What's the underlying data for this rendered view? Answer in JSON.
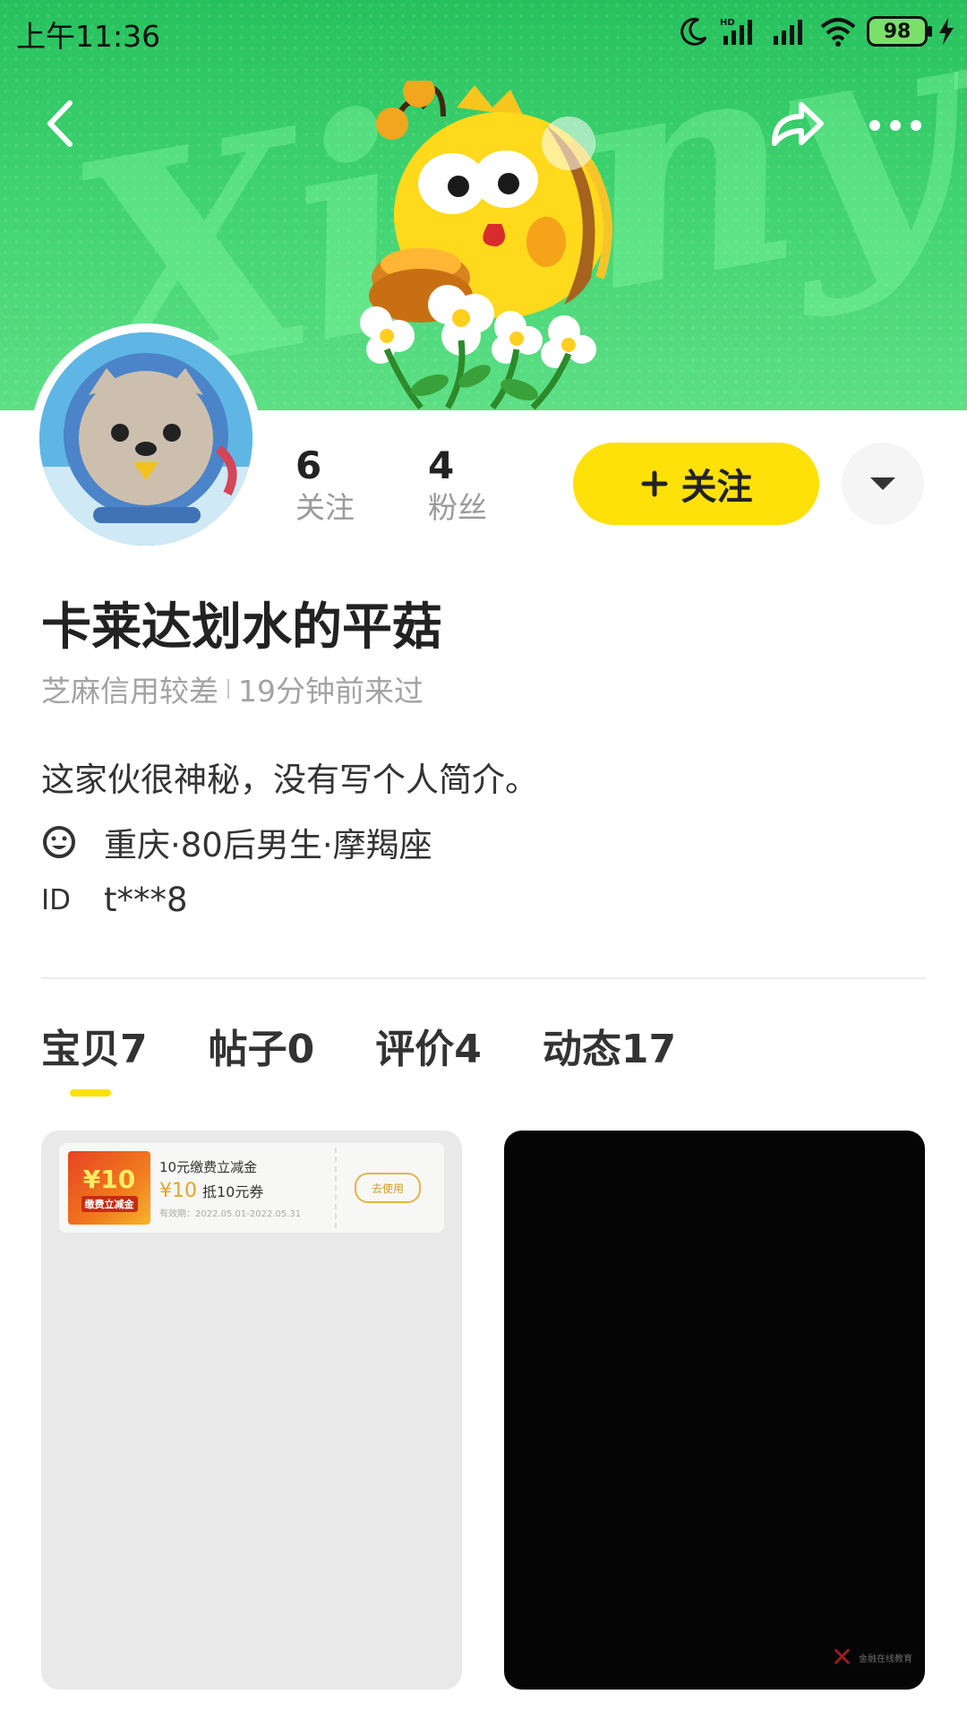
{
  "status_bar": {
    "time": "上午11:36",
    "battery": "98"
  },
  "profile": {
    "following_count": "6",
    "following_label": "关注",
    "followers_count": "4",
    "followers_label": "粉丝",
    "follow_button_label": "关注",
    "username": "卡莱达划水的平菇",
    "credit": "芝麻信用较差",
    "last_seen": "19分钟前来过",
    "bio": "这家伙很神秘，没有写个人简介。",
    "location_info": "重庆·80后男生·摩羯座",
    "id_label": "ID",
    "id_value": "t***8"
  },
  "tabs": [
    {
      "label": "宝贝",
      "count": "7"
    },
    {
      "label": "帖子",
      "count": "0"
    },
    {
      "label": "评价",
      "count": "4"
    },
    {
      "label": "动态",
      "count": "17"
    }
  ],
  "cards": {
    "coupon": {
      "image_text": "¥10",
      "image_subtext": "缴费立减金",
      "title": "10元缴费立减金",
      "amount": "¥10",
      "amount_desc": "抵10元券",
      "valid": "有效期：2022.05.01-2022.05.31",
      "button": "去使用"
    },
    "watermark_text": "金融在线教育"
  },
  "colors": {
    "accent_yellow": "#ffe10a",
    "banner_green": "#3fd26f"
  },
  "icons": {
    "back": "back-arrow-icon",
    "share": "share-icon",
    "more": "more-dots-icon",
    "dropdown": "caret-down-icon",
    "smiley": "smiley-icon"
  }
}
